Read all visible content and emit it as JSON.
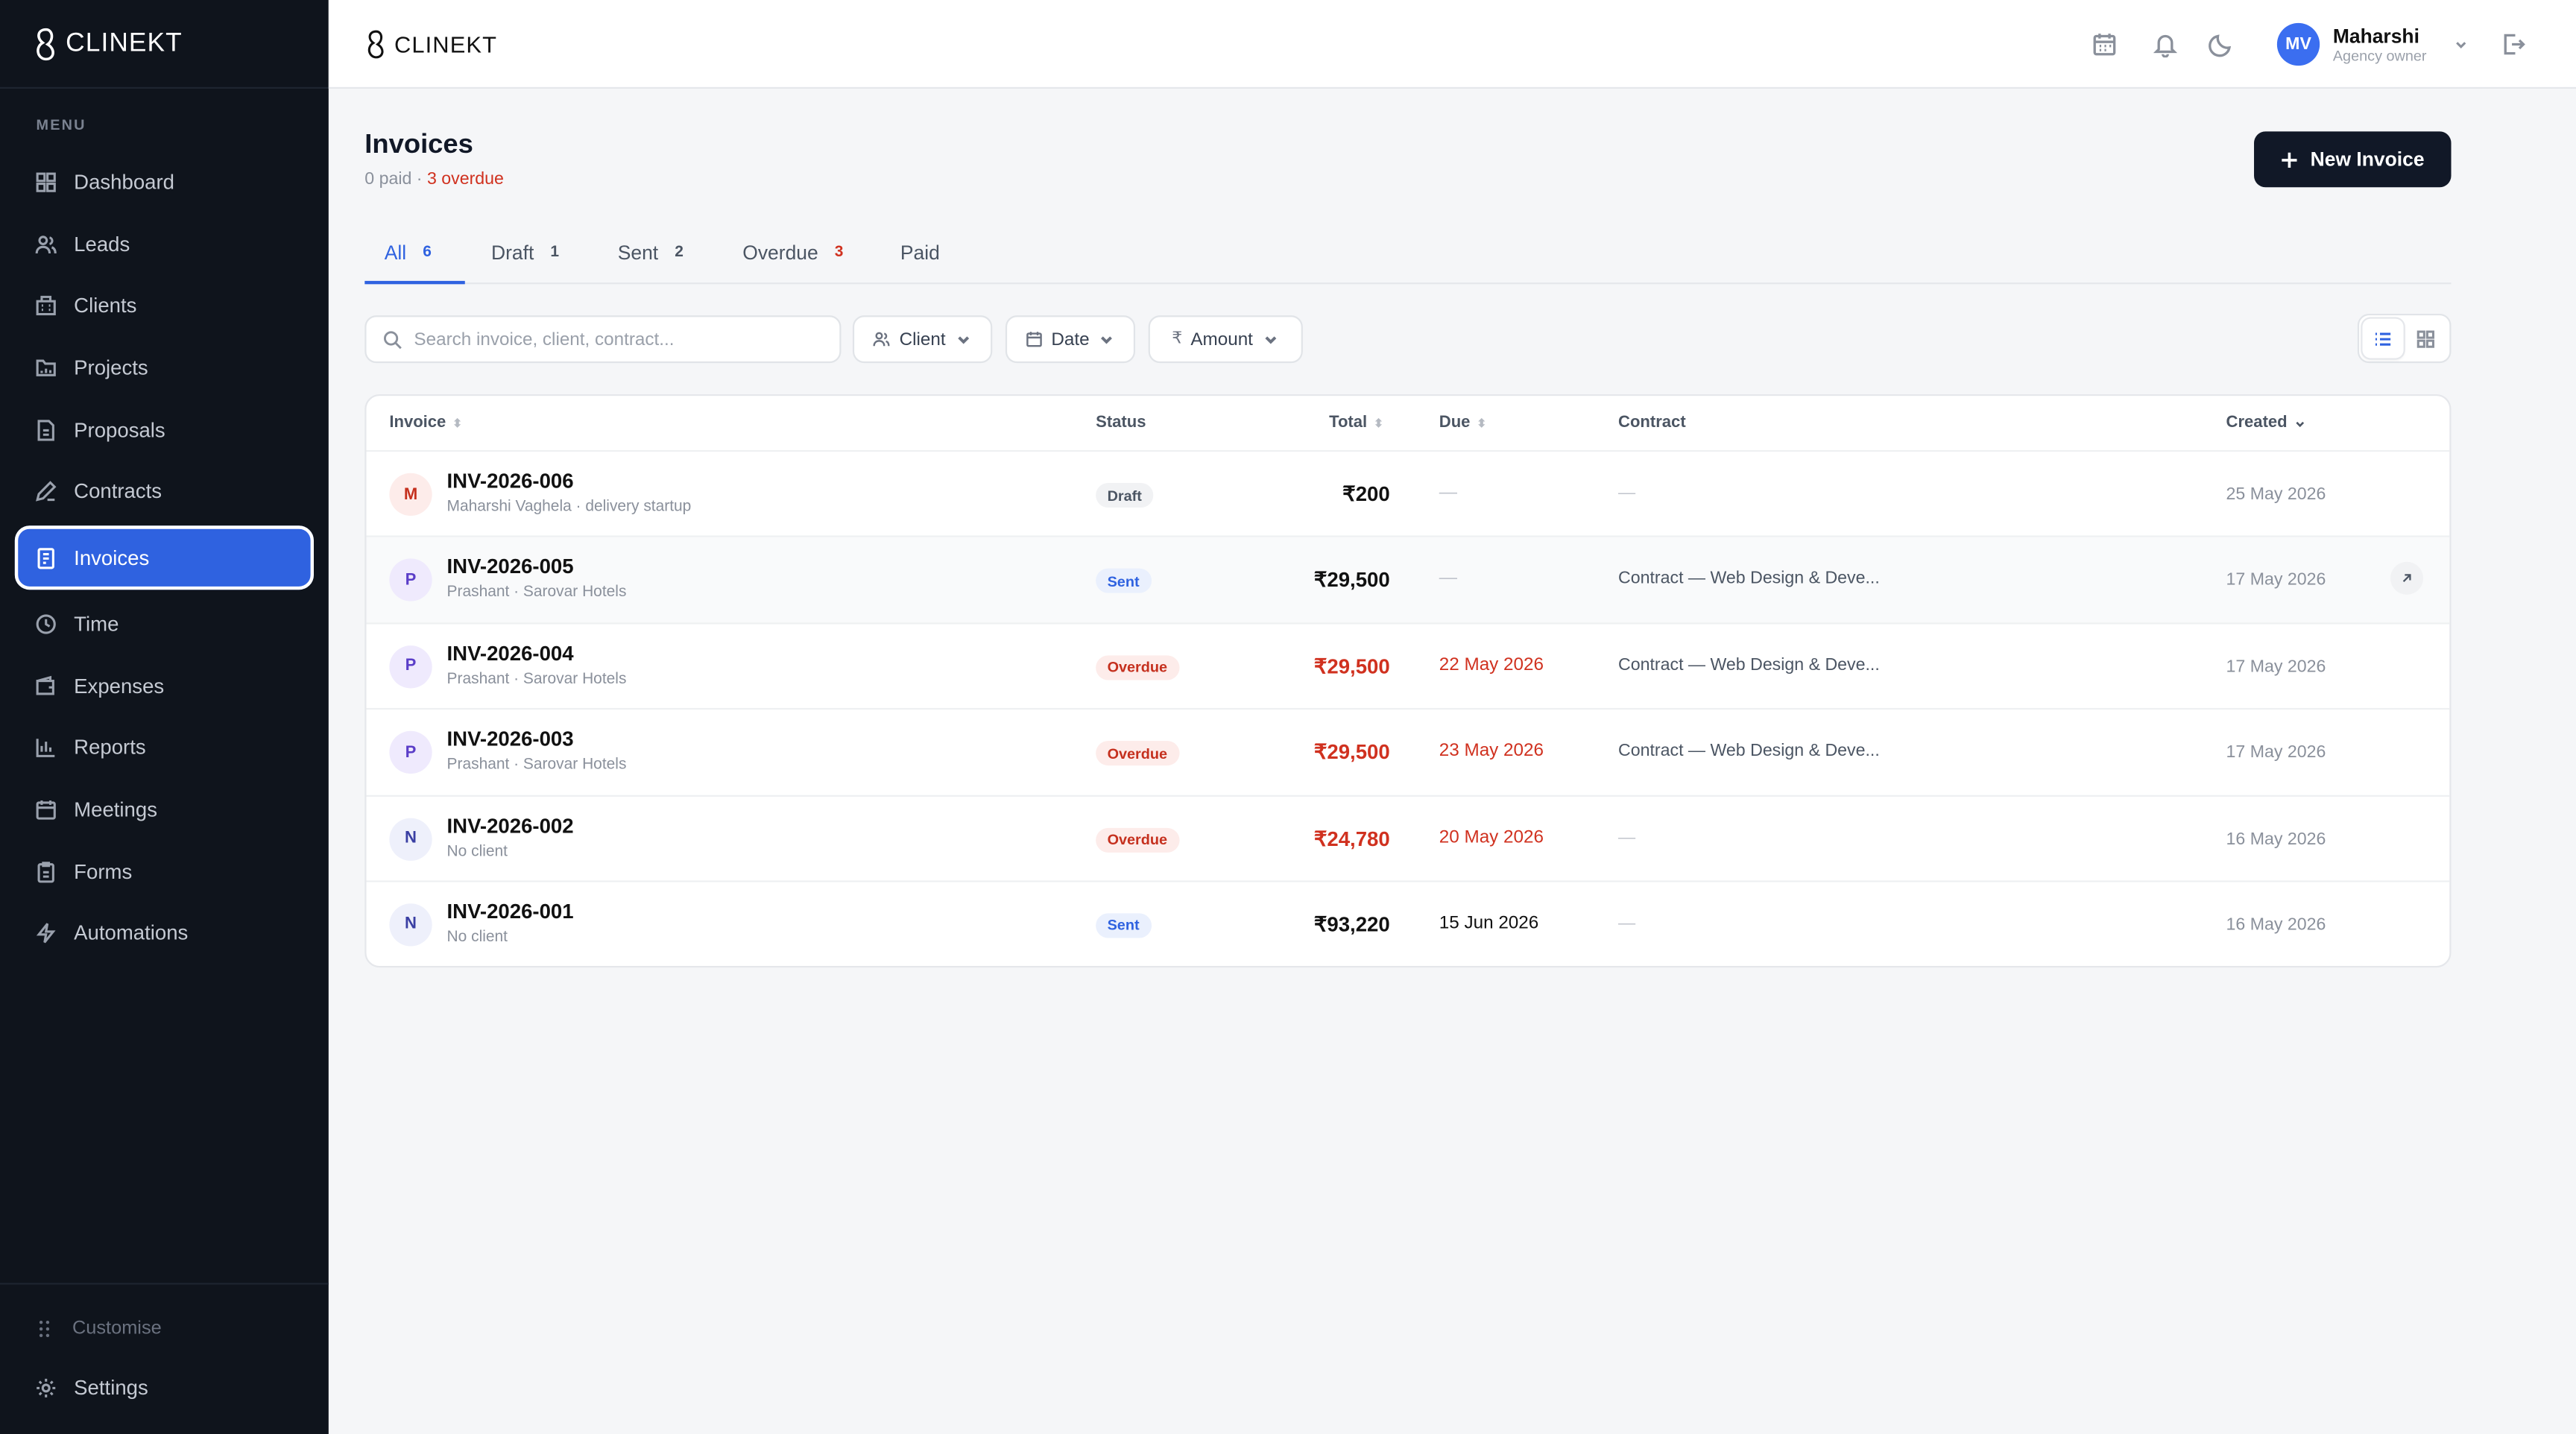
{
  "brand": {
    "name": "CLINEKT"
  },
  "sidebar": {
    "menu_label": "MENU",
    "items": [
      {
        "label": "Dashboard",
        "icon": "grid-icon"
      },
      {
        "label": "Leads",
        "icon": "users-icon"
      },
      {
        "label": "Clients",
        "icon": "building-icon"
      },
      {
        "label": "Projects",
        "icon": "folder-icon"
      },
      {
        "label": "Proposals",
        "icon": "file-icon"
      },
      {
        "label": "Contracts",
        "icon": "pen-icon"
      },
      {
        "label": "Invoices",
        "icon": "receipt-icon",
        "active": true
      },
      {
        "label": "Time",
        "icon": "clock-icon"
      },
      {
        "label": "Expenses",
        "icon": "wallet-icon"
      },
      {
        "label": "Reports",
        "icon": "bar-chart-icon"
      },
      {
        "label": "Meetings",
        "icon": "calendar-icon"
      },
      {
        "label": "Forms",
        "icon": "clipboard-icon"
      },
      {
        "label": "Automations",
        "icon": "zap-icon"
      }
    ],
    "customise_label": "Customise",
    "settings_label": "Settings"
  },
  "user": {
    "initials": "MV",
    "name": "Maharshi",
    "role": "Agency owner"
  },
  "page": {
    "title": "Invoices",
    "sub_paid": "0 paid",
    "sub_sep": " · ",
    "sub_overdue": "3 overdue",
    "new_button": "New Invoice"
  },
  "tabs": [
    {
      "label": "All",
      "count": "6"
    },
    {
      "label": "Draft",
      "count": "1"
    },
    {
      "label": "Sent",
      "count": "2"
    },
    {
      "label": "Overdue",
      "count": "3"
    },
    {
      "label": "Paid",
      "count": ""
    }
  ],
  "search": {
    "placeholder": "Search invoice, client, contract..."
  },
  "filters": {
    "client": "Client",
    "date": "Date",
    "amount": "Amount",
    "amount_symbol": "₹"
  },
  "table": {
    "headers": {
      "invoice": "Invoice",
      "status": "Status",
      "total": "Total",
      "due": "Due",
      "contract": "Contract",
      "created": "Created"
    },
    "rows": [
      {
        "initial": "M",
        "id": "INV-2026-006",
        "sub": "Maharshi Vaghela · delivery startup",
        "status": "Draft",
        "total": "₹200",
        "due": "—",
        "contract": "—",
        "created": "25 May 2026"
      },
      {
        "initial": "P",
        "id": "INV-2026-005",
        "sub": "Prashant · Sarovar Hotels",
        "status": "Sent",
        "total": "₹29,500",
        "due": "—",
        "contract": "Contract — Web Design & Deve...",
        "created": "17 May 2026"
      },
      {
        "initial": "P",
        "id": "INV-2026-004",
        "sub": "Prashant · Sarovar Hotels",
        "status": "Overdue",
        "total": "₹29,500",
        "due": "22 May 2026",
        "contract": "Contract — Web Design & Deve...",
        "created": "17 May 2026"
      },
      {
        "initial": "P",
        "id": "INV-2026-003",
        "sub": "Prashant · Sarovar Hotels",
        "status": "Overdue",
        "total": "₹29,500",
        "due": "23 May 2026",
        "contract": "Contract — Web Design & Deve...",
        "created": "17 May 2026"
      },
      {
        "initial": "N",
        "id": "INV-2026-002",
        "sub": "No client",
        "status": "Overdue",
        "total": "₹24,780",
        "due": "20 May 2026",
        "contract": "—",
        "created": "16 May 2026"
      },
      {
        "initial": "N",
        "id": "INV-2026-001",
        "sub": "No client",
        "status": "Sent",
        "total": "₹93,220",
        "due": "15 Jun 2026",
        "contract": "—",
        "created": "16 May 2026"
      }
    ]
  },
  "colors": {
    "accent": "#2f62e0",
    "overdue": "#d0311f",
    "sidebar_bg": "#0f141c",
    "primary_button": "#111827"
  }
}
